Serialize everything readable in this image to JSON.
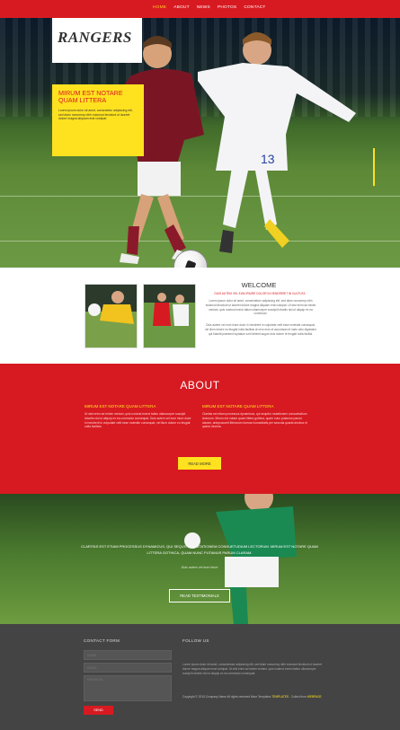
{
  "nav": {
    "items": [
      "HOME",
      "ABOUT",
      "NEWS",
      "PHOTOS",
      "CONTACT"
    ],
    "active_index": 0
  },
  "hero": {
    "logo": "RANGERS",
    "promo_title": "MIRUM EST NOTARE QUAM LITTERA",
    "promo_text": "Lorem ipsum dolor sit amet, consectetur adipiscing elit, sed diam nonummy nibh euismod tincidunt ut laoreet dolore magna aliquam erat volutpat."
  },
  "welcome": {
    "title": "WELCOME",
    "subtitle": "DUIS AUTEM VEL EUM IRIURE DOLOR IN HENDRERIT IN VULPUTA",
    "text1": "Lorem ipsum dolor sit amet, consectetuer adipiscing elit, sed diam nonummy nibh euismod tincidunt ut laoreet dolore magna aliquam erat volutpat. Ut wisi enim ad minim veniam, quis nostrud exerci tation ullamcorper suscipit lobortis nisl ut aliquip ex ea commodo.",
    "text2": "Duis autem vel eum iriure dolor in hendrerit in vulputate velit esse molestie consequat, vel illum dolore eu feugiat nulla facilisis at vero eros et accumsan et iusto odio dignissim qui blandit praesent luptatum zzril delenit augue duis dolore te feugait nulla facilisi."
  },
  "about": {
    "title": "ABOUT",
    "col1_title": "MIRUM EST NOTARE QUAM LITTERA",
    "col1_text": "Ut wisi enim ad minim veniam, quis nostrud exerci tation ullamcorper suscipit lobortis nisl ut aliquip ex ea commodo consequat. Duis autem vel eum iriure dolor in hendrerit in vulputate velit esse molestie consequat, vel illum dolore eu feugiat nulla facilisis.",
    "col2_title": "MIRUM EST NOTARE QUAM LITTERA",
    "col2_text": "Claritas est etiam processus dynamicus, qui sequitur mutationem consuetudium lectorum. Mirum est notare quam littera gothica, quam nunc putamus parum claram, anteposuerit litterarum formas humanitatis per seacula quarta decima et quinta decima.",
    "button": "READ MORE"
  },
  "testimonial": {
    "text": "CLARITAS EST ETIAM PROCESSUS DYNAMICUS, QUI SEQUITUR MUTATIONEM CONSUETUDIUM LECTORUM. MIRUM EST NOTARE QUAM LITTERA GOTHICA, QUAM NUNC PUTAMUS PARUM CLARAM.",
    "author": "Duis autem vel eum iriure",
    "button": "READ TESTIMONIALS"
  },
  "footer": {
    "contact_title": "CONTACT FORM",
    "name_placeholder": "NAME",
    "email_placeholder": "EMAIL",
    "message_placeholder": "MESSAGE",
    "send": "SEND",
    "follow_title": "FOLLOW US",
    "follow_text": "Lorem ipsum dolor sit amet, consectetuer adipiscing elit, sed diam nonummy nibh euismod tincidunt ut laoreet dolore magna aliquam erat volutpat. Ut wisi enim ad minim veniam, quis nostrud exerci tation ullamcorper suscipit lobortis nisl ut aliquip ex ea commodo consequat.",
    "copyright_prefix": "Copyright © 2015 Company Name All rights reserved More Templates",
    "copyright_link1": "TEMPLATES",
    "copyright_mid": "- Collect from",
    "copyright_link2": "WEBPAGE"
  },
  "colors": {
    "brand_red": "#d71a21",
    "accent_yellow": "#ffe21f",
    "footer_gray": "#444444"
  }
}
